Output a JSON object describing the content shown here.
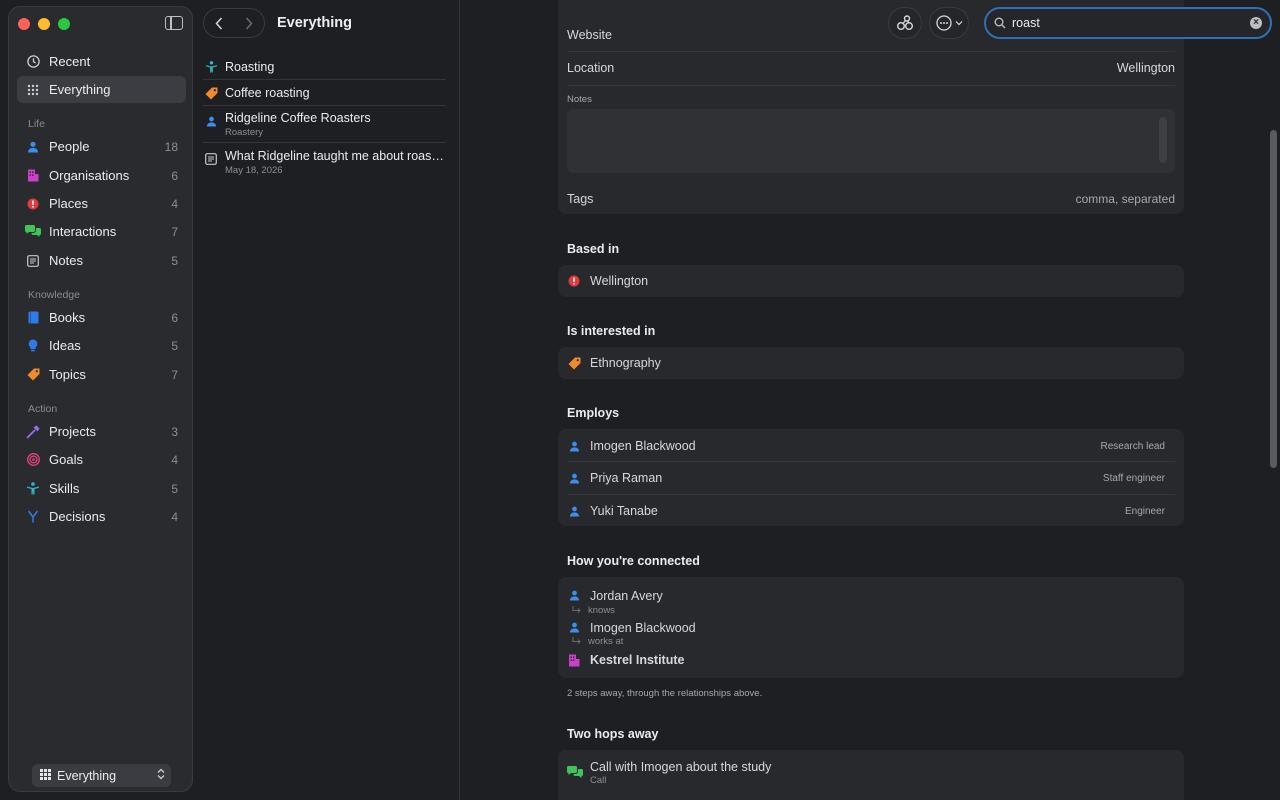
{
  "sidebar": {
    "items": [
      {
        "label": "Recent",
        "count": "",
        "icon": "clock-icon"
      },
      {
        "label": "Everything",
        "count": "",
        "icon": "grid-icon"
      },
      {
        "label": "People",
        "count": "18",
        "icon": "person-icon"
      },
      {
        "label": "Organisations",
        "count": "6",
        "icon": "building-icon"
      },
      {
        "label": "Places",
        "count": "4",
        "icon": "pin-icon"
      },
      {
        "label": "Interactions",
        "count": "7",
        "icon": "chat-bubbles-icon"
      },
      {
        "label": "Notes",
        "count": "5",
        "icon": "note-icon"
      },
      {
        "label": "Books",
        "count": "6",
        "icon": "book-icon"
      },
      {
        "label": "Ideas",
        "count": "5",
        "icon": "lightbulb-icon"
      },
      {
        "label": "Topics",
        "count": "7",
        "icon": "tag-icon"
      },
      {
        "label": "Projects",
        "count": "3",
        "icon": "hammer-icon"
      },
      {
        "label": "Goals",
        "count": "4",
        "icon": "target-icon"
      },
      {
        "label": "Skills",
        "count": "5",
        "icon": "skill-figure-icon"
      },
      {
        "label": "Decisions",
        "count": "4",
        "icon": "branch-icon"
      }
    ],
    "sections": {
      "life": "Life",
      "knowledge": "Knowledge",
      "action": "Action"
    },
    "footer_select": "Everything"
  },
  "list": {
    "title": "Everything",
    "results": [
      {
        "title": "Roasting",
        "sub": ""
      },
      {
        "title": "Coffee roasting",
        "sub": ""
      },
      {
        "title": "Ridgeline Coffee Roasters",
        "sub": "Roastery"
      },
      {
        "title": "What Ridgeline taught me about roast…",
        "sub": "May 18, 2026"
      }
    ]
  },
  "search": {
    "value": "roast"
  },
  "detail": {
    "fields": {
      "website_label": "Website",
      "location_label": "Location",
      "location_value": "Wellington",
      "notes_label": "Notes",
      "tags_label": "Tags",
      "tags_placeholder": "comma, separated"
    },
    "based_in": {
      "heading": "Based in",
      "item": "Wellington"
    },
    "interested_in": {
      "heading": "Is interested in",
      "item": "Ethnography"
    },
    "employs": {
      "heading": "Employs",
      "people": [
        {
          "name": "Imogen Blackwood",
          "role": "Research lead"
        },
        {
          "name": "Priya Raman",
          "role": "Staff engineer"
        },
        {
          "name": "Yuki Tanabe",
          "role": "Engineer"
        }
      ]
    },
    "connected": {
      "heading": "How you're connected",
      "chain": [
        {
          "name": "Jordan Avery",
          "rel": "knows"
        },
        {
          "name": "Imogen Blackwood",
          "rel": "works at"
        },
        {
          "name": "Kestrel Institute",
          "rel": ""
        }
      ],
      "hint": "2 steps away, through the relationships above."
    },
    "two_hops": {
      "heading": "Two hops away",
      "item": {
        "title": "Call with Imogen about the study",
        "sub": "Call"
      }
    }
  },
  "colors": {
    "accent": "#2f6fb6",
    "person": "#3b8eea",
    "org": "#c940c9",
    "place": "#e5393b",
    "topic": "#f08a2c",
    "interaction": "#3fc35a"
  }
}
